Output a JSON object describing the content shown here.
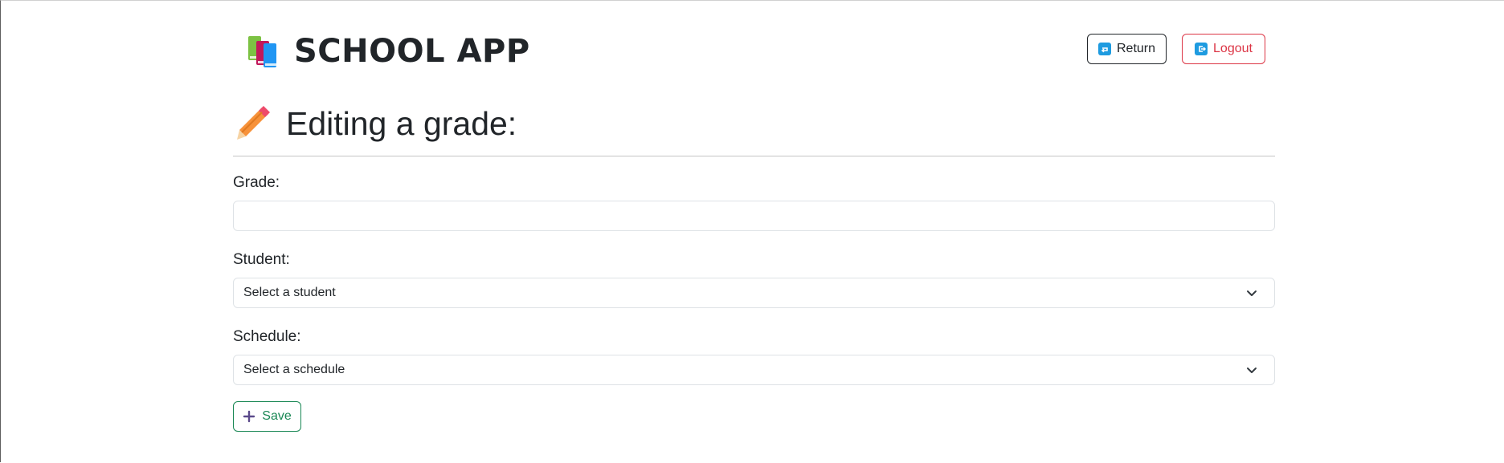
{
  "header": {
    "app_title": "SCHOOL APP",
    "brand_icon": "books-icon",
    "return_label": "Return",
    "return_icon": "return-arrow-icon",
    "logout_label": "Logout",
    "logout_icon": "logout-arrow-icon"
  },
  "page": {
    "title": "Editing a grade:",
    "title_icon": "pencil-icon"
  },
  "form": {
    "grade_label": "Grade:",
    "grade_value": "",
    "student_label": "Student:",
    "student_selected": "Select a student",
    "schedule_label": "Schedule:",
    "schedule_selected": "Select a schedule",
    "save_label": "Save",
    "save_icon": "plus-icon"
  },
  "colors": {
    "primary_text": "#212529",
    "danger": "#dc3545",
    "success": "#198754",
    "icon_blue": "#1e9be0"
  }
}
